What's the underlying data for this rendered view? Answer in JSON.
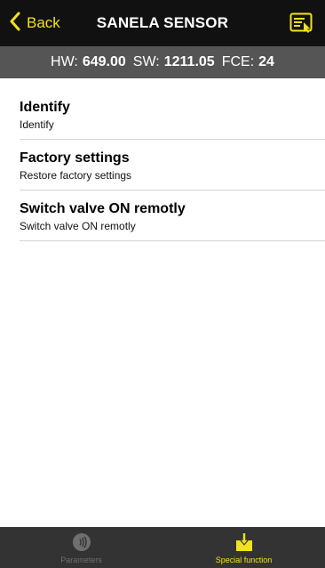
{
  "navbar": {
    "back_label": "Back",
    "title": "SANELA SENSOR",
    "action_icon": "list-select-icon",
    "accent": "#f2e21b"
  },
  "info": {
    "hw_label": "HW:",
    "hw_value": "649.00",
    "sw_label": "SW:",
    "sw_value": "1211.05",
    "fce_label": "FCE:",
    "fce_value": "24"
  },
  "items": [
    {
      "title": "Identify",
      "subtitle": "Identify"
    },
    {
      "title": "Factory settings",
      "subtitle": "Restore factory settings"
    },
    {
      "title": "Switch valve ON remotly",
      "subtitle": "Switch valve ON remotly"
    }
  ],
  "tabs": [
    {
      "label": "Parameters",
      "icon": "sensor-wave-icon",
      "active": false
    },
    {
      "label": "Special function",
      "icon": "download-icon",
      "active": true
    }
  ],
  "colors": {
    "navbar_bg": "#111111",
    "infobar_bg": "#555555",
    "tabbar_bg": "#333333",
    "accent": "#f2e21b"
  }
}
